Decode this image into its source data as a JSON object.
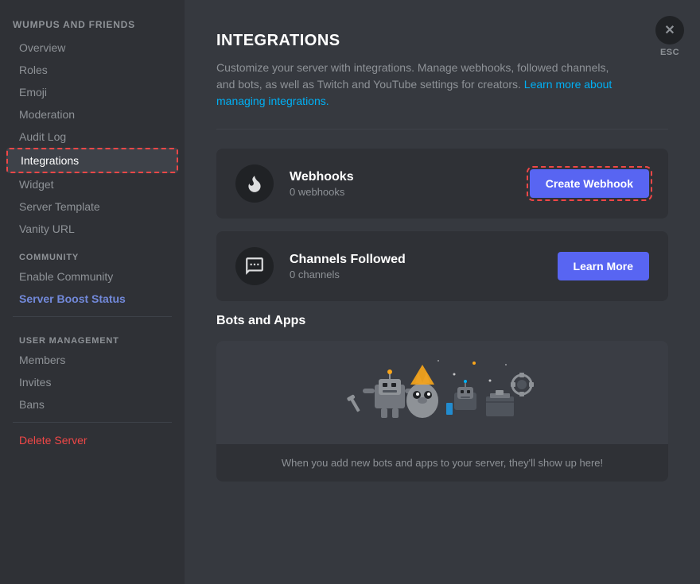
{
  "sidebar": {
    "server_name": "WUMPUS AND FRIENDS",
    "items": [
      {
        "id": "overview",
        "label": "Overview",
        "active": false,
        "boost": false,
        "delete": false
      },
      {
        "id": "roles",
        "label": "Roles",
        "active": false,
        "boost": false,
        "delete": false
      },
      {
        "id": "emoji",
        "label": "Emoji",
        "active": false,
        "boost": false,
        "delete": false
      },
      {
        "id": "moderation",
        "label": "Moderation",
        "active": false,
        "boost": false,
        "delete": false
      },
      {
        "id": "audit-log",
        "label": "Audit Log",
        "active": false,
        "boost": false,
        "delete": false
      },
      {
        "id": "integrations",
        "label": "Integrations",
        "active": true,
        "boost": false,
        "delete": false
      },
      {
        "id": "widget",
        "label": "Widget",
        "active": false,
        "boost": false,
        "delete": false
      },
      {
        "id": "server-template",
        "label": "Server Template",
        "active": false,
        "boost": false,
        "delete": false
      },
      {
        "id": "vanity-url",
        "label": "Vanity URL",
        "active": false,
        "boost": false,
        "delete": false
      }
    ],
    "community_section": "COMMUNITY",
    "community_items": [
      {
        "id": "enable-community",
        "label": "Enable Community"
      }
    ],
    "server_boost": "Server Boost Status",
    "user_management_section": "USER MANAGEMENT",
    "user_management_items": [
      {
        "id": "members",
        "label": "Members"
      },
      {
        "id": "invites",
        "label": "Invites"
      },
      {
        "id": "bans",
        "label": "Bans"
      }
    ],
    "delete_server": "Delete Server"
  },
  "main": {
    "title": "INTEGRATIONS",
    "description_text": "Customize your server with integrations. Manage webhooks, followed channels, and bots, as well as Twitch and YouTube settings for creators.",
    "description_link_text": "Learn more about managing integrations.",
    "description_link_href": "#",
    "webhooks_title": "Webhooks",
    "webhooks_count": "0 webhooks",
    "create_webhook_label": "Create Webhook",
    "channels_followed_title": "Channels Followed",
    "channels_count": "0 channels",
    "learn_more_label": "Learn More",
    "bots_title": "Bots and Apps",
    "bots_empty_text": "When you add new bots and apps to your server, they'll show up here!",
    "esc_label": "ESC"
  },
  "icons": {
    "webhook": "⚙",
    "channels": "📋",
    "close": "✕"
  }
}
